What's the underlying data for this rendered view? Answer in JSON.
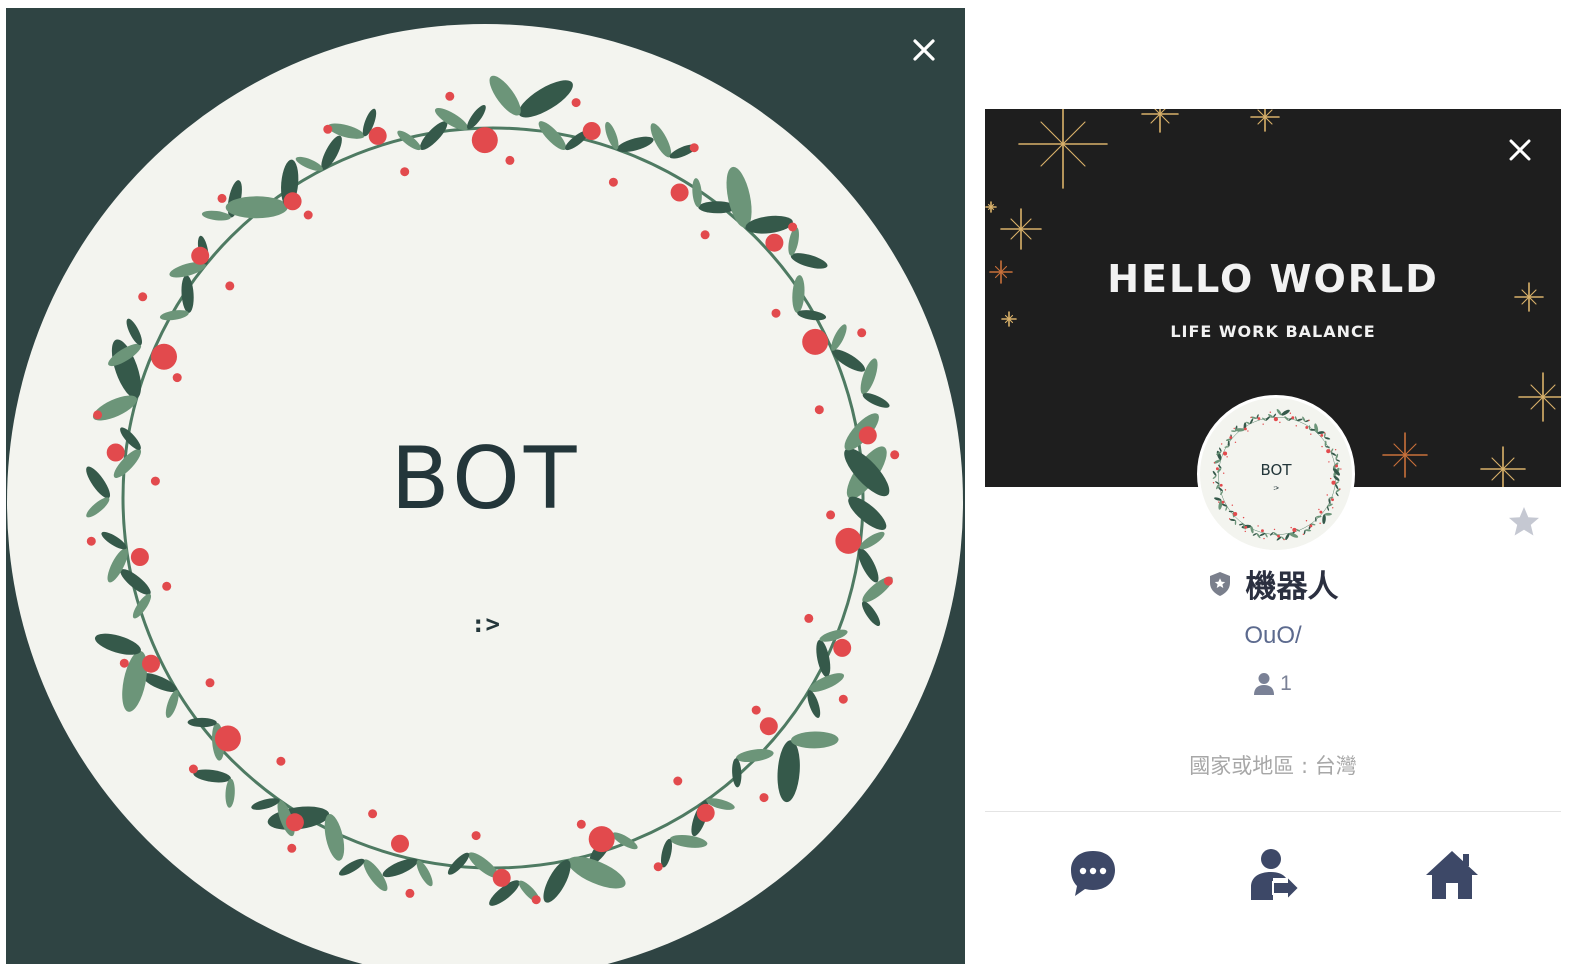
{
  "preview": {
    "image_text": "BOT",
    "image_subtext": ":>",
    "colors": {
      "background": "#2f4443",
      "disc": "#f3f4ef",
      "text": "#23363a",
      "berry": "#e24a4d",
      "leaf_dark": "#35594a",
      "leaf_light": "#6c9579"
    },
    "close_icon": "close-icon"
  },
  "profile": {
    "cover": {
      "title": "HELLO WORLD",
      "subtitle": "LIFE WORK BALANCE",
      "colors": {
        "background": "#1e1e1e",
        "sparkle_gold": "#d9b16a",
        "sparkle_copper": "#c9703a"
      },
      "close_icon": "close-icon"
    },
    "avatar": {
      "text": "BOT",
      "subtext": ":>"
    },
    "favorite_icon": "star-icon",
    "official_badge_icon": "shield-star-icon",
    "name": "機器人",
    "status_message": "OuO/",
    "friend_count": "1",
    "friend_icon": "person-icon",
    "region": "國家或地區 : 台灣",
    "actions": [
      {
        "name": "chat",
        "icon": "chat-bubble-icon"
      },
      {
        "name": "share",
        "icon": "share-contact-icon"
      },
      {
        "name": "home",
        "icon": "home-icon"
      }
    ],
    "colors": {
      "name": "#2b3040",
      "status": "#5c6a8e",
      "icons": "#3d4867",
      "star": "#c5c8d2"
    }
  }
}
